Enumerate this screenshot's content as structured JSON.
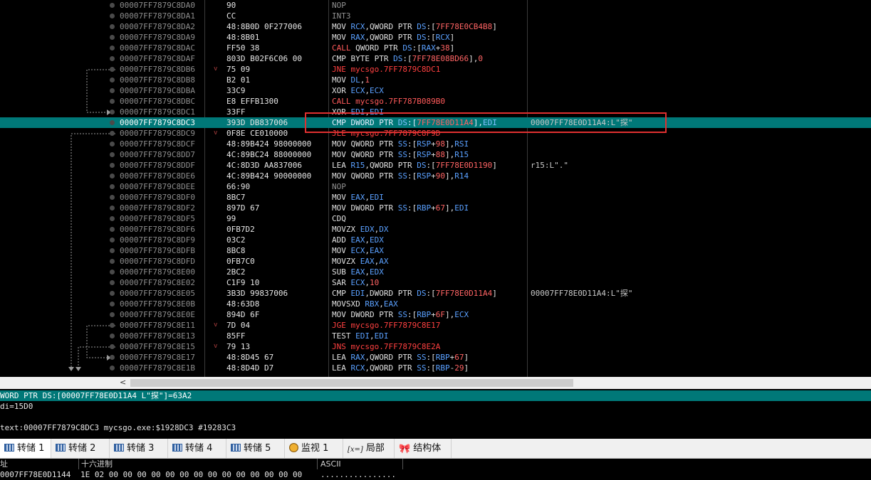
{
  "disasm": {
    "rows": [
      {
        "addr": "00007FF7879C8DA0",
        "bytes": "90",
        "instr": [
          [
            "NOP",
            "n"
          ]
        ],
        "comment": ""
      },
      {
        "addr": "00007FF7879C8DA1",
        "bytes": "CC",
        "instr": [
          [
            "INT3",
            "n"
          ]
        ],
        "comment": ""
      },
      {
        "addr": "00007FF7879C8DA2",
        "bytes": "48:8B0D 0F277006",
        "instr": [
          [
            "MOV ",
            "m"
          ],
          [
            "RCX",
            "r"
          ],
          [
            ",QWORD PTR ",
            "m"
          ],
          [
            "DS",
            "sg"
          ],
          [
            ":[",
            "m"
          ],
          [
            "7FF78E0CB4B8",
            "num"
          ],
          [
            "]",
            "m"
          ]
        ],
        "comment": ""
      },
      {
        "addr": "00007FF7879C8DA9",
        "bytes": "48:8B01",
        "instr": [
          [
            "MOV ",
            "m"
          ],
          [
            "RAX",
            "r"
          ],
          [
            ",QWORD PTR ",
            "m"
          ],
          [
            "DS",
            "sg"
          ],
          [
            ":[",
            "m"
          ],
          [
            "RCX",
            "r"
          ],
          [
            "]",
            "m"
          ]
        ],
        "comment": ""
      },
      {
        "addr": "00007FF7879C8DAC",
        "bytes": "FF50 38",
        "instr": [
          [
            "CALL ",
            "c"
          ],
          [
            "QWORD PTR ",
            "m"
          ],
          [
            "DS",
            "sg"
          ],
          [
            ":[",
            "m"
          ],
          [
            "RAX",
            "r"
          ],
          [
            "+",
            "m"
          ],
          [
            "38",
            "num"
          ],
          [
            "]",
            "m"
          ]
        ],
        "comment": ""
      },
      {
        "addr": "00007FF7879C8DAF",
        "bytes": "803D B02F6C06 00",
        "instr": [
          [
            "CMP ",
            "m"
          ],
          [
            "BYTE PTR ",
            "m"
          ],
          [
            "DS",
            "sg"
          ],
          [
            ":[",
            "m"
          ],
          [
            "7FF78E08BD66",
            "num"
          ],
          [
            "],",
            "m"
          ],
          [
            "0",
            "num"
          ]
        ],
        "comment": ""
      },
      {
        "addr": "00007FF7879C8DB6",
        "bytes": "75 09",
        "arrow": "v",
        "instr": [
          [
            "JNE ",
            "j"
          ],
          [
            "mycsgo.7FF7879C8DC1",
            "j"
          ]
        ],
        "comment": ""
      },
      {
        "addr": "00007FF7879C8DB8",
        "bytes": "B2 01",
        "instr": [
          [
            "MOV ",
            "m"
          ],
          [
            "DL",
            "r"
          ],
          [
            ",",
            "m"
          ],
          [
            "1",
            "num"
          ]
        ],
        "comment": ""
      },
      {
        "addr": "00007FF7879C8DBA",
        "bytes": "33C9",
        "instr": [
          [
            "XOR ",
            "m"
          ],
          [
            "ECX",
            "r"
          ],
          [
            ",",
            "m"
          ],
          [
            "ECX",
            "r"
          ]
        ],
        "comment": ""
      },
      {
        "addr": "00007FF7879C8DBC",
        "bytes": "E8 EFFB1300",
        "instr": [
          [
            "CALL ",
            "c"
          ],
          [
            "mycsgo.7FF787B089B0",
            "c"
          ]
        ],
        "comment": ""
      },
      {
        "addr": "00007FF7879C8DC1",
        "bytes": "33FF",
        "instr": [
          [
            "XOR ",
            "m"
          ],
          [
            "EDI",
            "r"
          ],
          [
            ",",
            "m"
          ],
          [
            "EDI",
            "r"
          ]
        ],
        "comment": ""
      },
      {
        "addr": "00007FF7879C8DC3",
        "bytes": "393D DB837006",
        "selected": true,
        "instr": [
          [
            "CMP ",
            "m"
          ],
          [
            "DWORD PTR ",
            "m"
          ],
          [
            "DS",
            "sg"
          ],
          [
            ":[",
            "m"
          ],
          [
            "7FF78E0D11A4",
            "num"
          ],
          [
            "],",
            "m"
          ],
          [
            "EDI",
            "r"
          ]
        ],
        "comment": "00007FF78E0D11A4:L\"探\""
      },
      {
        "addr": "00007FF7879C8DC9",
        "bytes": "0F8E CE010000",
        "arrow": "v",
        "instr": [
          [
            "JLE ",
            "j"
          ],
          [
            "mycsgo.7FF7879C8F9D",
            "j"
          ]
        ],
        "comment": ""
      },
      {
        "addr": "00007FF7879C8DCF",
        "bytes": "48:89B424 98000000",
        "instr": [
          [
            "MOV ",
            "m"
          ],
          [
            "QWORD PTR ",
            "m"
          ],
          [
            "SS",
            "sg"
          ],
          [
            ":[",
            "m"
          ],
          [
            "RSP",
            "r"
          ],
          [
            "+",
            "m"
          ],
          [
            "98",
            "num"
          ],
          [
            "],",
            "m"
          ],
          [
            "RSI",
            "r"
          ]
        ],
        "comment": ""
      },
      {
        "addr": "00007FF7879C8DD7",
        "bytes": "4C:89BC24 88000000",
        "instr": [
          [
            "MOV ",
            "m"
          ],
          [
            "QWORD PTR ",
            "m"
          ],
          [
            "SS",
            "sg"
          ],
          [
            ":[",
            "m"
          ],
          [
            "RSP",
            "r"
          ],
          [
            "+",
            "m"
          ],
          [
            "88",
            "num"
          ],
          [
            "],",
            "m"
          ],
          [
            "R15",
            "r"
          ]
        ],
        "comment": ""
      },
      {
        "addr": "00007FF7879C8DDF",
        "bytes": "4C:8D3D AA837006",
        "instr": [
          [
            "LEA ",
            "m"
          ],
          [
            "R15",
            "r"
          ],
          [
            ",QWORD PTR ",
            "m"
          ],
          [
            "DS",
            "sg"
          ],
          [
            ":[",
            "m"
          ],
          [
            "7FF78E0D1190",
            "num"
          ],
          [
            "]",
            "m"
          ]
        ],
        "comment": "r15:L\".\""
      },
      {
        "addr": "00007FF7879C8DE6",
        "bytes": "4C:89B424 90000000",
        "instr": [
          [
            "MOV ",
            "m"
          ],
          [
            "QWORD PTR ",
            "m"
          ],
          [
            "SS",
            "sg"
          ],
          [
            ":[",
            "m"
          ],
          [
            "RSP",
            "r"
          ],
          [
            "+",
            "m"
          ],
          [
            "90",
            "num"
          ],
          [
            "],",
            "m"
          ],
          [
            "R14",
            "r"
          ]
        ],
        "comment": ""
      },
      {
        "addr": "00007FF7879C8DEE",
        "bytes": "66:90",
        "instr": [
          [
            "NOP",
            "n"
          ]
        ],
        "comment": ""
      },
      {
        "addr": "00007FF7879C8DF0",
        "bytes": "8BC7",
        "instr": [
          [
            "MOV ",
            "m"
          ],
          [
            "EAX",
            "r"
          ],
          [
            ",",
            "m"
          ],
          [
            "EDI",
            "r"
          ]
        ],
        "comment": ""
      },
      {
        "addr": "00007FF7879C8DF2",
        "bytes": "897D 67",
        "instr": [
          [
            "MOV ",
            "m"
          ],
          [
            "DWORD PTR ",
            "m"
          ],
          [
            "SS",
            "sg"
          ],
          [
            ":[",
            "m"
          ],
          [
            "RBP",
            "r"
          ],
          [
            "+",
            "m"
          ],
          [
            "67",
            "num"
          ],
          [
            "],",
            "m"
          ],
          [
            "EDI",
            "r"
          ]
        ],
        "comment": ""
      },
      {
        "addr": "00007FF7879C8DF5",
        "bytes": "99",
        "instr": [
          [
            "CDQ",
            "m"
          ]
        ],
        "comment": ""
      },
      {
        "addr": "00007FF7879C8DF6",
        "bytes": "0FB7D2",
        "instr": [
          [
            "MOVZX ",
            "m"
          ],
          [
            "EDX",
            "r"
          ],
          [
            ",",
            "m"
          ],
          [
            "DX",
            "r"
          ]
        ],
        "comment": ""
      },
      {
        "addr": "00007FF7879C8DF9",
        "bytes": "03C2",
        "instr": [
          [
            "ADD ",
            "m"
          ],
          [
            "EAX",
            "r"
          ],
          [
            ",",
            "m"
          ],
          [
            "EDX",
            "r"
          ]
        ],
        "comment": ""
      },
      {
        "addr": "00007FF7879C8DFB",
        "bytes": "8BC8",
        "instr": [
          [
            "MOV ",
            "m"
          ],
          [
            "ECX",
            "r"
          ],
          [
            ",",
            "m"
          ],
          [
            "EAX",
            "r"
          ]
        ],
        "comment": ""
      },
      {
        "addr": "00007FF7879C8DFD",
        "bytes": "0FB7C0",
        "instr": [
          [
            "MOVZX ",
            "m"
          ],
          [
            "EAX",
            "r"
          ],
          [
            ",",
            "m"
          ],
          [
            "AX",
            "r"
          ]
        ],
        "comment": ""
      },
      {
        "addr": "00007FF7879C8E00",
        "bytes": "2BC2",
        "instr": [
          [
            "SUB ",
            "m"
          ],
          [
            "EAX",
            "r"
          ],
          [
            ",",
            "m"
          ],
          [
            "EDX",
            "r"
          ]
        ],
        "comment": ""
      },
      {
        "addr": "00007FF7879C8E02",
        "bytes": "C1F9 10",
        "instr": [
          [
            "SAR ",
            "m"
          ],
          [
            "ECX",
            "r"
          ],
          [
            ",",
            "m"
          ],
          [
            "10",
            "num"
          ]
        ],
        "comment": ""
      },
      {
        "addr": "00007FF7879C8E05",
        "bytes": "3B3D 99837006",
        "instr": [
          [
            "CMP ",
            "m"
          ],
          [
            "EDI",
            "r"
          ],
          [
            ",DWORD PTR ",
            "m"
          ],
          [
            "DS",
            "sg"
          ],
          [
            ":[",
            "m"
          ],
          [
            "7FF78E0D11A4",
            "num"
          ],
          [
            "]",
            "m"
          ]
        ],
        "comment": "00007FF78E0D11A4:L\"探\""
      },
      {
        "addr": "00007FF7879C8E0B",
        "bytes": "48:63D8",
        "instr": [
          [
            "MOVSXD ",
            "m"
          ],
          [
            "RBX",
            "r"
          ],
          [
            ",",
            "m"
          ],
          [
            "EAX",
            "r"
          ]
        ],
        "comment": ""
      },
      {
        "addr": "00007FF7879C8E0E",
        "bytes": "894D 6F",
        "instr": [
          [
            "MOV ",
            "m"
          ],
          [
            "DWORD PTR ",
            "m"
          ],
          [
            "SS",
            "sg"
          ],
          [
            ":[",
            "m"
          ],
          [
            "RBP",
            "r"
          ],
          [
            "+",
            "m"
          ],
          [
            "6F",
            "num"
          ],
          [
            "],",
            "m"
          ],
          [
            "ECX",
            "r"
          ]
        ],
        "comment": ""
      },
      {
        "addr": "00007FF7879C8E11",
        "bytes": "7D 04",
        "arrow": "v",
        "instr": [
          [
            "JGE ",
            "j"
          ],
          [
            "mycsgo.7FF7879C8E17",
            "j"
          ]
        ],
        "comment": ""
      },
      {
        "addr": "00007FF7879C8E13",
        "bytes": "85FF",
        "instr": [
          [
            "TEST ",
            "m"
          ],
          [
            "EDI",
            "r"
          ],
          [
            ",",
            "m"
          ],
          [
            "EDI",
            "r"
          ]
        ],
        "comment": ""
      },
      {
        "addr": "00007FF7879C8E15",
        "bytes": "79 13",
        "arrow": "v",
        "instr": [
          [
            "JNS ",
            "j"
          ],
          [
            "mycsgo.7FF7879C8E2A",
            "j"
          ]
        ],
        "comment": ""
      },
      {
        "addr": "00007FF7879C8E17",
        "bytes": "48:8D45 67",
        "instr": [
          [
            "LEA ",
            "m"
          ],
          [
            "RAX",
            "r"
          ],
          [
            ",QWORD PTR ",
            "m"
          ],
          [
            "SS",
            "sg"
          ],
          [
            ":[",
            "m"
          ],
          [
            "RBP",
            "r"
          ],
          [
            "+",
            "m"
          ],
          [
            "67",
            "num"
          ],
          [
            "]",
            "m"
          ]
        ],
        "comment": ""
      },
      {
        "addr": "00007FF7879C8E1B",
        "bytes": "48:8D4D D7",
        "instr": [
          [
            "LEA ",
            "m"
          ],
          [
            "RCX",
            "r"
          ],
          [
            ",QWORD PTR ",
            "m"
          ],
          [
            "SS",
            "sg"
          ],
          [
            ":[",
            "m"
          ],
          [
            "RBP",
            "r"
          ],
          [
            "-",
            "m"
          ],
          [
            "29",
            "num"
          ],
          [
            "]",
            "m"
          ]
        ],
        "comment": ""
      }
    ]
  },
  "scrollbar": {
    "left_arrow": "<"
  },
  "info": {
    "line1": "WORD PTR DS:[00007FF78E0D11A4 L\"探\"]=63A2",
    "line2": "di=15D0",
    "line3": "",
    "line4": "text:00007FF7879C8DC3 mycsgo.exe:$1928DC3 #19283C3"
  },
  "tabs": [
    {
      "label": "转储 1",
      "icon": "memory-dump-icon",
      "active": true
    },
    {
      "label": "转储 2",
      "icon": "memory-dump-icon"
    },
    {
      "label": "转储 3",
      "icon": "memory-dump-icon"
    },
    {
      "label": "转储 4",
      "icon": "memory-dump-icon"
    },
    {
      "label": "转储 5",
      "icon": "memory-dump-icon"
    },
    {
      "label": "监视 1",
      "icon": "watch-icon"
    },
    {
      "label": "局部",
      "icon": "locals-icon",
      "icon_text": "[x=]"
    },
    {
      "label": "结构体",
      "icon": "struct-icon",
      "icon_text": "🎀"
    }
  ],
  "memory": {
    "headers": {
      "addr": "址",
      "hex": "十六进制",
      "ascii": "ASCII"
    },
    "row": {
      "addr": "0007FF78E0D1144",
      "hex": "1E 02 00 00 00 00 00 00 00 00 00 00 00 00 00 00",
      "ascii": "................"
    }
  }
}
